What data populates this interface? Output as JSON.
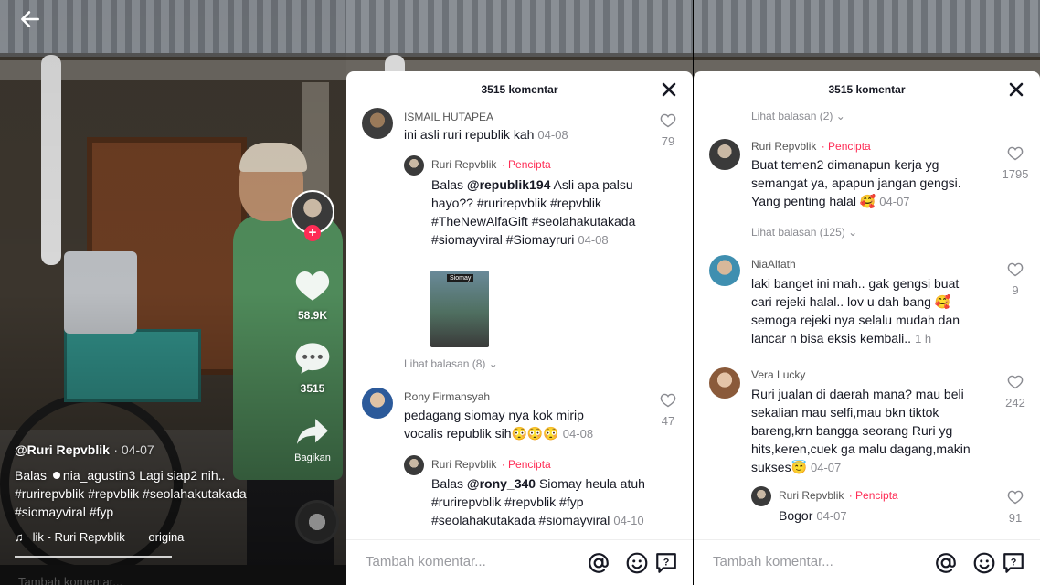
{
  "panel1": {
    "likes": "58.9K",
    "comments": "3515",
    "share_label": "Bagikan",
    "username": "@Ruri Repvblik",
    "date": "· 04-07",
    "caption_prefix": "Balas",
    "caption_mention": "nia_agustin3",
    "caption_text": "Lagi siap2 nih..",
    "caption_tags": "#rurirepvblik #repvblik #seolahakutakada #siomayviral #fyp",
    "music": "lik - Ruri Repvblik",
    "music_orig": "origina",
    "add_comment": "Tambah komentar..."
  },
  "panel2": {
    "header": "3515 komentar",
    "comments": [
      {
        "user": "ISMAIL HUTAPEA",
        "text": "ini asli ruri republik kah",
        "date": "04-08",
        "likes": "79"
      },
      {
        "user": "Ruri Repvblik",
        "creator": "· Pencipta",
        "prefix": "Balas",
        "handle": "@republik194",
        "text": "Asli apa palsu hayo?? #rurirepvblik #repvblik #TheNewAlfaGift #seolahakutakada #siomayviral #Siomayruri",
        "date": "04-08",
        "thumb_tag": "Siomay"
      },
      {
        "replies": "Lihat balasan (8)"
      },
      {
        "user": "Rony Firmansyah",
        "text": "pedagang siomay nya kok mirip vocalis republik sih😳😳😳",
        "date": "04-08",
        "likes": "47"
      },
      {
        "user": "Ruri Repvblik",
        "creator": "· Pencipta",
        "prefix": "Balas",
        "handle": "@rony_340",
        "text": "Siomay heula atuh #rurirepvblik #repvblik #fyp #seolahakutakada #siomayviral",
        "date": "04-10"
      }
    ],
    "placeholder": "Tambah komentar..."
  },
  "panel3": {
    "header": "3515 komentar",
    "top_replies": "Lihat balasan (2)",
    "comments": [
      {
        "user": "Ruri Repvblik",
        "creator": "· Pencipta",
        "text": "Buat temen2 dimanapun kerja yg semangat ya, apapun jangan gengsi. Yang penting halal 🥰",
        "date": "04-07",
        "likes": "1795"
      },
      {
        "replies": "Lihat balasan (125)"
      },
      {
        "user": "NiaAlfath",
        "text": "laki banget ini mah.. gak gengsi buat cari rejeki halal.. lov u dah bang 🥰 semoga rejeki nya selalu mudah dan lancar n bisa eksis kembali..",
        "date": "1 h",
        "likes": "9"
      },
      {
        "user": "Vera Lucky",
        "text": "Ruri jualan di daerah mana? mau beli sekalian mau selfi,mau bkn tiktok bareng,krn bangga seorang Ruri yg hits,keren,cuek ga malu dagang,makin sukses😇",
        "date": "04-07",
        "likes": "242"
      },
      {
        "user": "Ruri Repvblik",
        "creator": "· Pencipta",
        "text": "Bogor",
        "date": "04-07",
        "likes": "91"
      }
    ],
    "placeholder": "Tambah komentar..."
  },
  "colors": {
    "accent": "#fe2c55",
    "text": "#161823",
    "muted": "#8a8b91"
  }
}
